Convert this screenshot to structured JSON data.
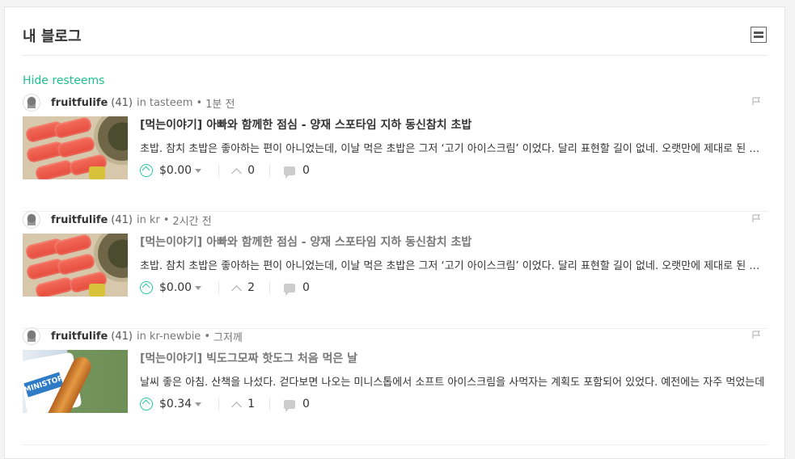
{
  "section_title": "내 블로그",
  "hide_resteems": "Hide resteems",
  "posts": [
    {
      "author": "fruitfulife",
      "reputation": "(41)",
      "in_label": "in",
      "category": "tasteem",
      "dot": "•",
      "time": "1분 전",
      "title": "[먹는이야기] 아빠와 함께한 점심 - 양재 스포타임 지하 동신참치 초밥",
      "excerpt": "초밥. 참치 초밥은 좋아하는 편이 아니었는데, 이날 먹은 초밥은 그저 ‘고기 아이스크림’ 이었다. 달리 표현할 길이 없네. 오랫만에 제대로 된 참치 초밥을 맛보았다.",
      "payout": "$0.00",
      "votes": "0",
      "comments": "0",
      "thumbnail": "sushi"
    },
    {
      "author": "fruitfulife",
      "reputation": "(41)",
      "in_label": "in",
      "category": "kr",
      "dot": "•",
      "time": "2시간 전",
      "title": "[먹는이야기] 아빠와 함께한 점심 - 양재 스포타임 지하 동신참치 초밥",
      "excerpt": "초밥. 참치 초밥은 좋아하는 편이 아니었는데, 이날 먹은 초밥은 그저 ‘고기 아이스크림’ 이었다. 달리 표현할 길이 없네. 오랫만에 제대로 된 참치 초밥을 맛보았다.",
      "payout": "$0.00",
      "votes": "2",
      "comments": "0",
      "thumbnail": "sushi"
    },
    {
      "author": "fruitfulife",
      "reputation": "(41)",
      "in_label": "in",
      "category": "kr-newbie",
      "dot": "•",
      "time": "그저께",
      "title": "[먹는이야기] 빅도그모짜 핫도그 처음 먹은 날",
      "excerpt": "날씨 좋은 아침. 산책을 나섰다. 걷다보면 나오는 미니스톱에서 소프트 아이스크림을 사먹자는 계획도 포함되어 있었다. 예전에는 자주 먹었는데",
      "payout": "$0.34",
      "votes": "1",
      "comments": "0",
      "thumbnail": "hotdog",
      "thumbnail_text": "MINISTOP"
    }
  ]
}
